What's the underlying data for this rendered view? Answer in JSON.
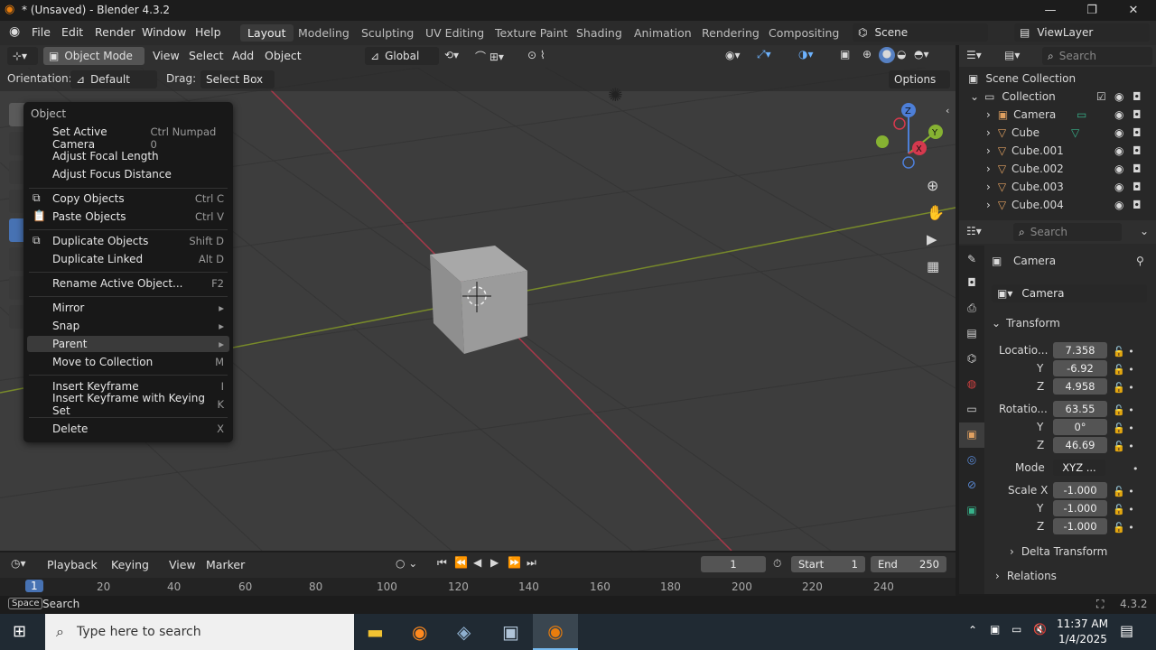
{
  "window": {
    "title": "* (Unsaved) - Blender 4.3.2"
  },
  "menus": [
    "File",
    "Edit",
    "Render",
    "Window",
    "Help"
  ],
  "workspaces": [
    "Layout",
    "Modeling",
    "Sculpting",
    "UV Editing",
    "Texture Paint",
    "Shading",
    "Animation",
    "Rendering",
    "Compositing"
  ],
  "active_workspace": "Layout",
  "scene": "Scene",
  "view_layer": "ViewLayer",
  "viewport": {
    "mode": "Object Mode",
    "menus": [
      "View",
      "Select",
      "Add",
      "Object"
    ],
    "transform": "Global",
    "orientation_label": "Orientation:",
    "orientation_value": "Default",
    "drag_label": "Drag:",
    "drag_value": "Select Box",
    "options": "Options"
  },
  "context_menu": {
    "title": "Object",
    "items": [
      {
        "label": "Set Active Camera",
        "shortcut": "Ctrl Numpad 0"
      },
      {
        "label": "Adjust Focal Length",
        "shortcut": ""
      },
      {
        "label": "Adjust Focus Distance",
        "shortcut": ""
      },
      {
        "label": "Copy Objects",
        "shortcut": "Ctrl C"
      },
      {
        "label": "Paste Objects",
        "shortcut": "Ctrl V"
      },
      {
        "label": "Duplicate Objects",
        "shortcut": "Shift D"
      },
      {
        "label": "Duplicate Linked",
        "shortcut": "Alt D"
      },
      {
        "label": "Rename Active Object...",
        "shortcut": "F2"
      },
      {
        "label": "Mirror",
        "shortcut": "▸"
      },
      {
        "label": "Snap",
        "shortcut": "▸"
      },
      {
        "label": "Parent",
        "shortcut": "▸"
      },
      {
        "label": "Move to Collection",
        "shortcut": "M"
      },
      {
        "label": "Insert Keyframe",
        "shortcut": "I"
      },
      {
        "label": "Insert Keyframe with Keying Set",
        "shortcut": "K"
      },
      {
        "label": "Delete",
        "shortcut": "X"
      }
    ]
  },
  "outliner": {
    "search_placeholder": "Search",
    "scene_collection": "Scene Collection",
    "collection": "Collection",
    "objects": [
      "Camera",
      "Cube",
      "Cube.001",
      "Cube.002",
      "Cube.003",
      "Cube.004"
    ]
  },
  "properties": {
    "search_placeholder": "Search",
    "object_name": "Camera",
    "data_name": "Camera",
    "transform_label": "Transform",
    "location_label": "Locatio...",
    "location": [
      "7.358",
      "-6.92",
      "4.958"
    ],
    "rotation_label": "Rotatio...",
    "rotation": [
      "63.55",
      "0°",
      "46.69"
    ],
    "mode_label": "Mode",
    "mode_value": "XYZ ...",
    "scale_label": "Scale X",
    "scale": [
      "-1.000",
      "-1.000",
      "-1.000"
    ],
    "axis_y": "Y",
    "axis_z": "Z",
    "delta_transform": "Delta Transform",
    "relations": "Relations"
  },
  "timeline": {
    "menus": [
      "Playback",
      "Keying",
      "View",
      "Marker"
    ],
    "current_frame": "1",
    "start_label": "Start",
    "start": "1",
    "end_label": "End",
    "end": "250",
    "ruler": [
      "1",
      "20",
      "40",
      "60",
      "80",
      "100",
      "120",
      "140",
      "160",
      "180",
      "200",
      "220",
      "240"
    ]
  },
  "statusbar": {
    "key": "Space",
    "action": "Search",
    "version": "4.3.2"
  },
  "taskbar": {
    "search_placeholder": "Type here to search",
    "time": "11:37 AM",
    "date": "1/4/2025"
  }
}
